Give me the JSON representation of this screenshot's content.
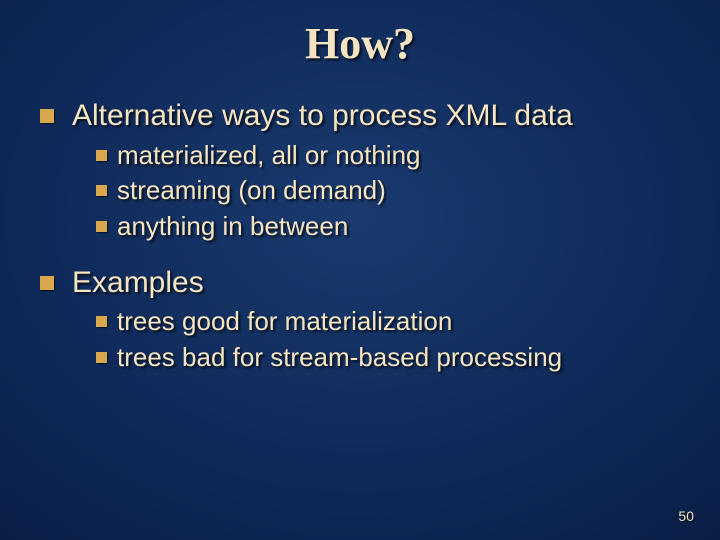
{
  "title": "How?",
  "sections": [
    {
      "heading": "Alternative ways to process XML data",
      "items": [
        " materialized, all or nothing",
        "streaming  (on demand)",
        "anything in between"
      ]
    },
    {
      "heading": "Examples",
      "items": [
        "trees good for materialization",
        "trees bad for stream-based processing"
      ]
    }
  ],
  "page_number": "50"
}
